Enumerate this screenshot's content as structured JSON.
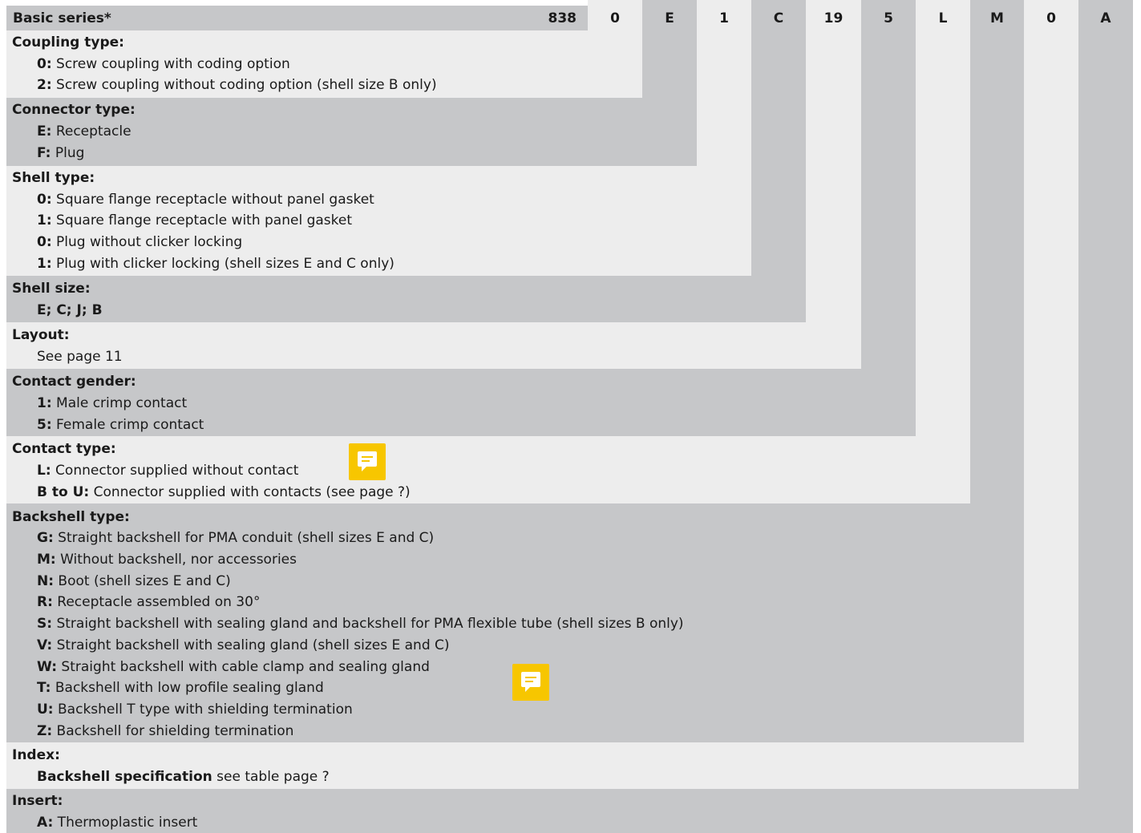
{
  "header": {
    "title": "Basic series*",
    "base": "838",
    "codes": [
      "0",
      "E",
      "1",
      "C",
      "19",
      "5",
      "L",
      "M",
      "0",
      "A"
    ]
  },
  "sections": [
    {
      "title": "Coupling type:",
      "lines": [
        {
          "code": "0:",
          "text": " Screw coupling with coding option"
        },
        {
          "code": "2:",
          "text": " Screw coupling without coding option (shell size B only)"
        }
      ]
    },
    {
      "title": "Connector type:",
      "lines": [
        {
          "code": "E:",
          "text": " Receptacle"
        },
        {
          "code": "F:",
          "text": " Plug"
        }
      ]
    },
    {
      "title": "Shell type:",
      "lines": [
        {
          "code": "0:",
          "text": " Square flange receptacle without panel gasket"
        },
        {
          "code": "1:",
          "text": " Square flange receptacle with panel gasket"
        },
        {
          "code": "0:",
          "text": " Plug without clicker locking"
        },
        {
          "code": "1:",
          "text": " Plug with clicker locking (shell sizes E and C only)"
        }
      ]
    },
    {
      "title": "Shell size:",
      "lines": [
        {
          "code": "E; C; J; B",
          "text": ""
        }
      ]
    },
    {
      "title": "Layout:",
      "lines": [
        {
          "code": "",
          "text": "See page 11"
        }
      ]
    },
    {
      "title": "Contact gender:",
      "lines": [
        {
          "code": "1:",
          "text": " Male crimp contact"
        },
        {
          "code": "5:",
          "text": " Female crimp contact"
        }
      ]
    },
    {
      "title": "Contact type:",
      "lines": [
        {
          "code": "L:",
          "text": " Connector supplied without contact"
        },
        {
          "code": "B to U:",
          "text": " Connector supplied with contacts (see page ?)"
        }
      ]
    },
    {
      "title": "Backshell type:",
      "lines": [
        {
          "code": "G:",
          "text": " Straight backshell for PMA conduit (shell sizes E and C)"
        },
        {
          "code": "M:",
          "text": " Without backshell, nor accessories"
        },
        {
          "code": "N:",
          "text": " Boot (shell sizes E and C)"
        },
        {
          "code": "R:",
          "text": " Receptacle assembled on 30°"
        },
        {
          "code": "S:",
          "text": " Straight backshell with sealing gland and backshell for PMA flexible tube (shell sizes B only)"
        },
        {
          "code": "V:",
          "text": " Straight backshell with sealing gland (shell sizes E and C)"
        },
        {
          "code": "W:",
          "text": " Straight backshell with cable clamp and sealing gland"
        },
        {
          "code": "T:",
          "text": " Backshell with low profile sealing gland"
        },
        {
          "code": "U:",
          "text": " Backshell T type with shielding termination"
        },
        {
          "code": "Z:",
          "text": " Backshell for shielding termination"
        }
      ]
    },
    {
      "title": "Index:",
      "lines": [
        {
          "code": "Backshell specification",
          "text": " see table page ?"
        }
      ]
    },
    {
      "title": "Insert:",
      "lines": [
        {
          "code": "A:",
          "text": " Thermoplastic insert"
        }
      ]
    }
  ],
  "icons": [
    "comment-icon",
    "comment-icon"
  ],
  "colors": {
    "dark": "#c6c7c9",
    "light": "#ededed",
    "accent": "#f7c600"
  }
}
